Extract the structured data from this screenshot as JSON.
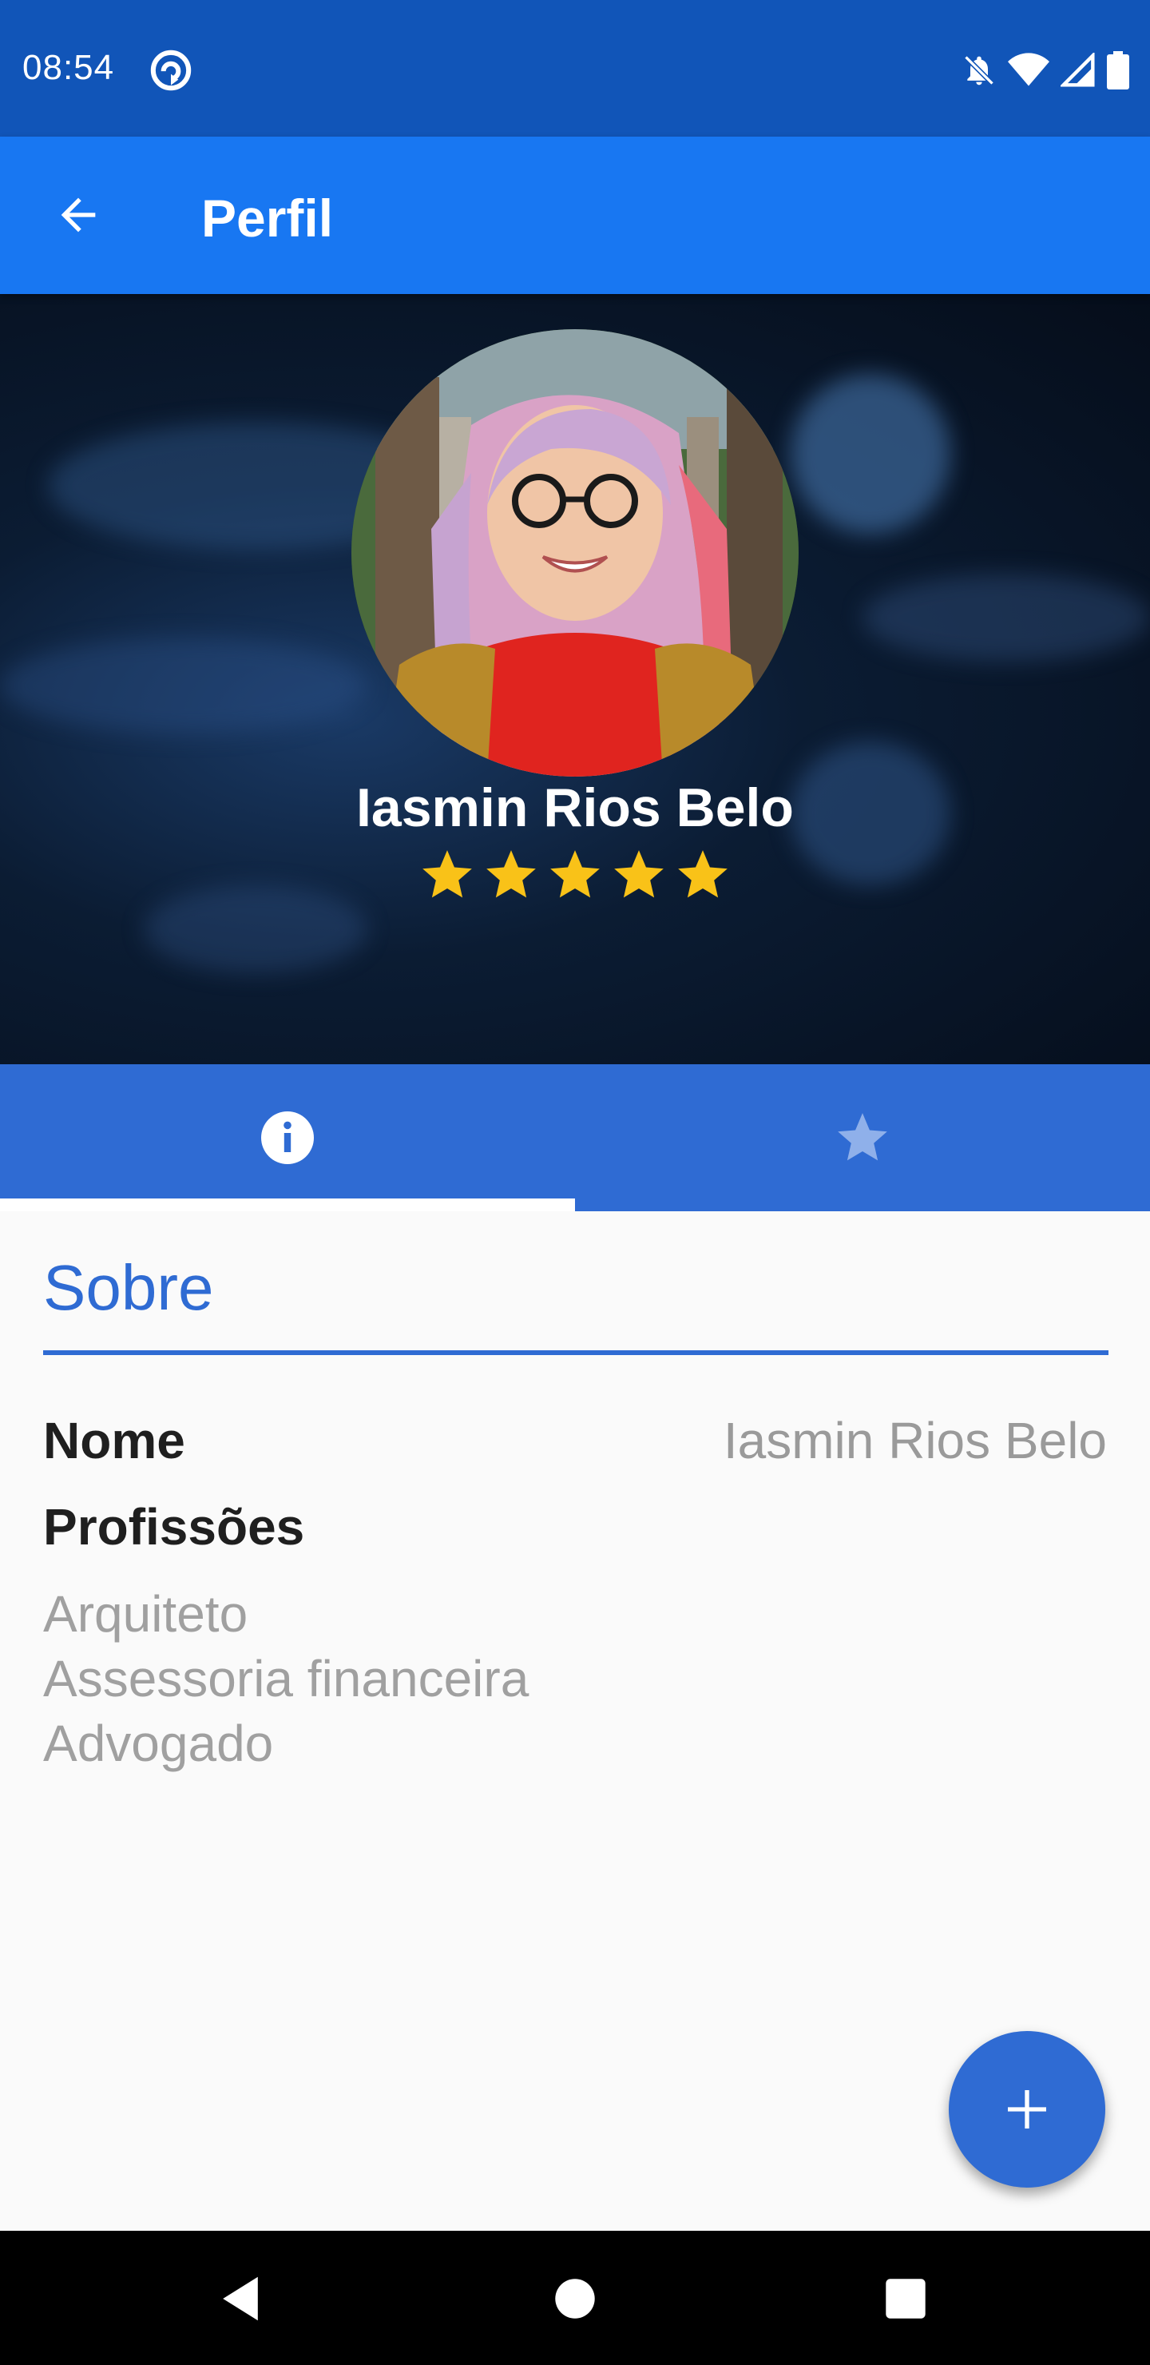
{
  "status_bar": {
    "time": "08:54",
    "icons": [
      "sync-icon",
      "bell-off-icon",
      "wifi-icon",
      "signal-icon",
      "battery-icon"
    ]
  },
  "app_bar": {
    "title": "Perfil",
    "back_icon": "arrow-left-icon"
  },
  "profile": {
    "name": "Iasmin Rios Belo",
    "rating": 5,
    "rating_max": 5
  },
  "tabs": [
    {
      "icon": "info-icon",
      "selected": true
    },
    {
      "icon": "star-icon",
      "selected": false
    }
  ],
  "about": {
    "section_title": "Sobre",
    "name_label": "Nome",
    "name_value": "Iasmin Rios Belo",
    "professions_label": "Profissões",
    "professions": [
      "Arquiteto",
      "Assessoria financeira",
      "Advogado"
    ]
  },
  "fab": {
    "icon": "plus-icon"
  },
  "nav": [
    "back-triangle-icon",
    "home-circle-icon",
    "recents-square-icon"
  ],
  "colors": {
    "status_bar": "#1155b8",
    "app_bar": "#1877f2",
    "tab_bar": "#2f6bd3",
    "accent": "#2f6bd3",
    "star": "#f9c218"
  }
}
